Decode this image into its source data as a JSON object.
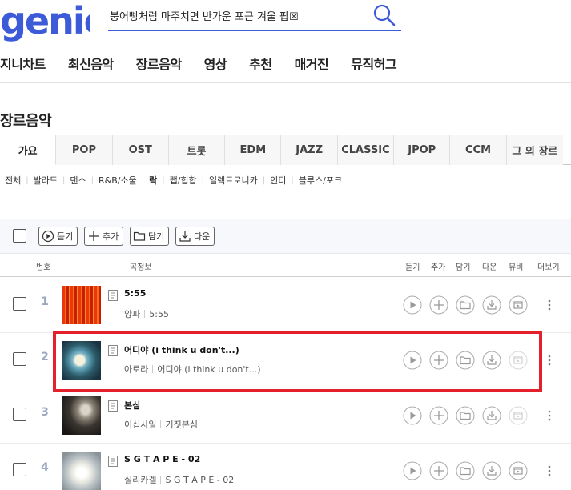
{
  "header": {
    "logo_text": "genie",
    "search_value": "붕어빵처럼 마주치면 반가운 포근 겨울 팝☒"
  },
  "gnb": [
    "지니차트",
    "최신음악",
    "장르음악",
    "영상",
    "추천",
    "매거진",
    "뮤직허그"
  ],
  "section_title": "장르음악",
  "genre_tabs": [
    "가요",
    "POP",
    "OST",
    "트롯",
    "EDM",
    "JAZZ",
    "CLASSIC",
    "JPOP",
    "CCM",
    "그 외 장르"
  ],
  "sub_genres": [
    "전체",
    "발라드",
    "댄스",
    "R&B/소울",
    "락",
    "랩/힙합",
    "일렉트로니카",
    "인디",
    "블루스/포크"
  ],
  "toolbar": {
    "listen": "듣기",
    "add": "추가",
    "save": "담기",
    "download": "다운"
  },
  "list_header": {
    "number": "번호",
    "song_info": "곡정보",
    "listen": "듣기",
    "add": "추가",
    "save": "담기",
    "download": "다운",
    "mv": "뮤비",
    "more": "더보기"
  },
  "songs": [
    {
      "rank": "1",
      "title": "5:55",
      "artist": "양파",
      "album": "5:55"
    },
    {
      "rank": "2",
      "title": "어디야 (i think u don't...)",
      "artist": "아로라",
      "album": "어디야 (i think u don't...)"
    },
    {
      "rank": "3",
      "title": "본심",
      "artist": "이십사일",
      "album": "거짓본심"
    },
    {
      "rank": "4",
      "title": "S G T A P E - 02",
      "artist": "실리카겔",
      "album": "S G T A P E - 02"
    }
  ],
  "colors": {
    "brand": "#3d5ad8",
    "highlight": "#e3202b",
    "rank": "#9ba7c0"
  }
}
